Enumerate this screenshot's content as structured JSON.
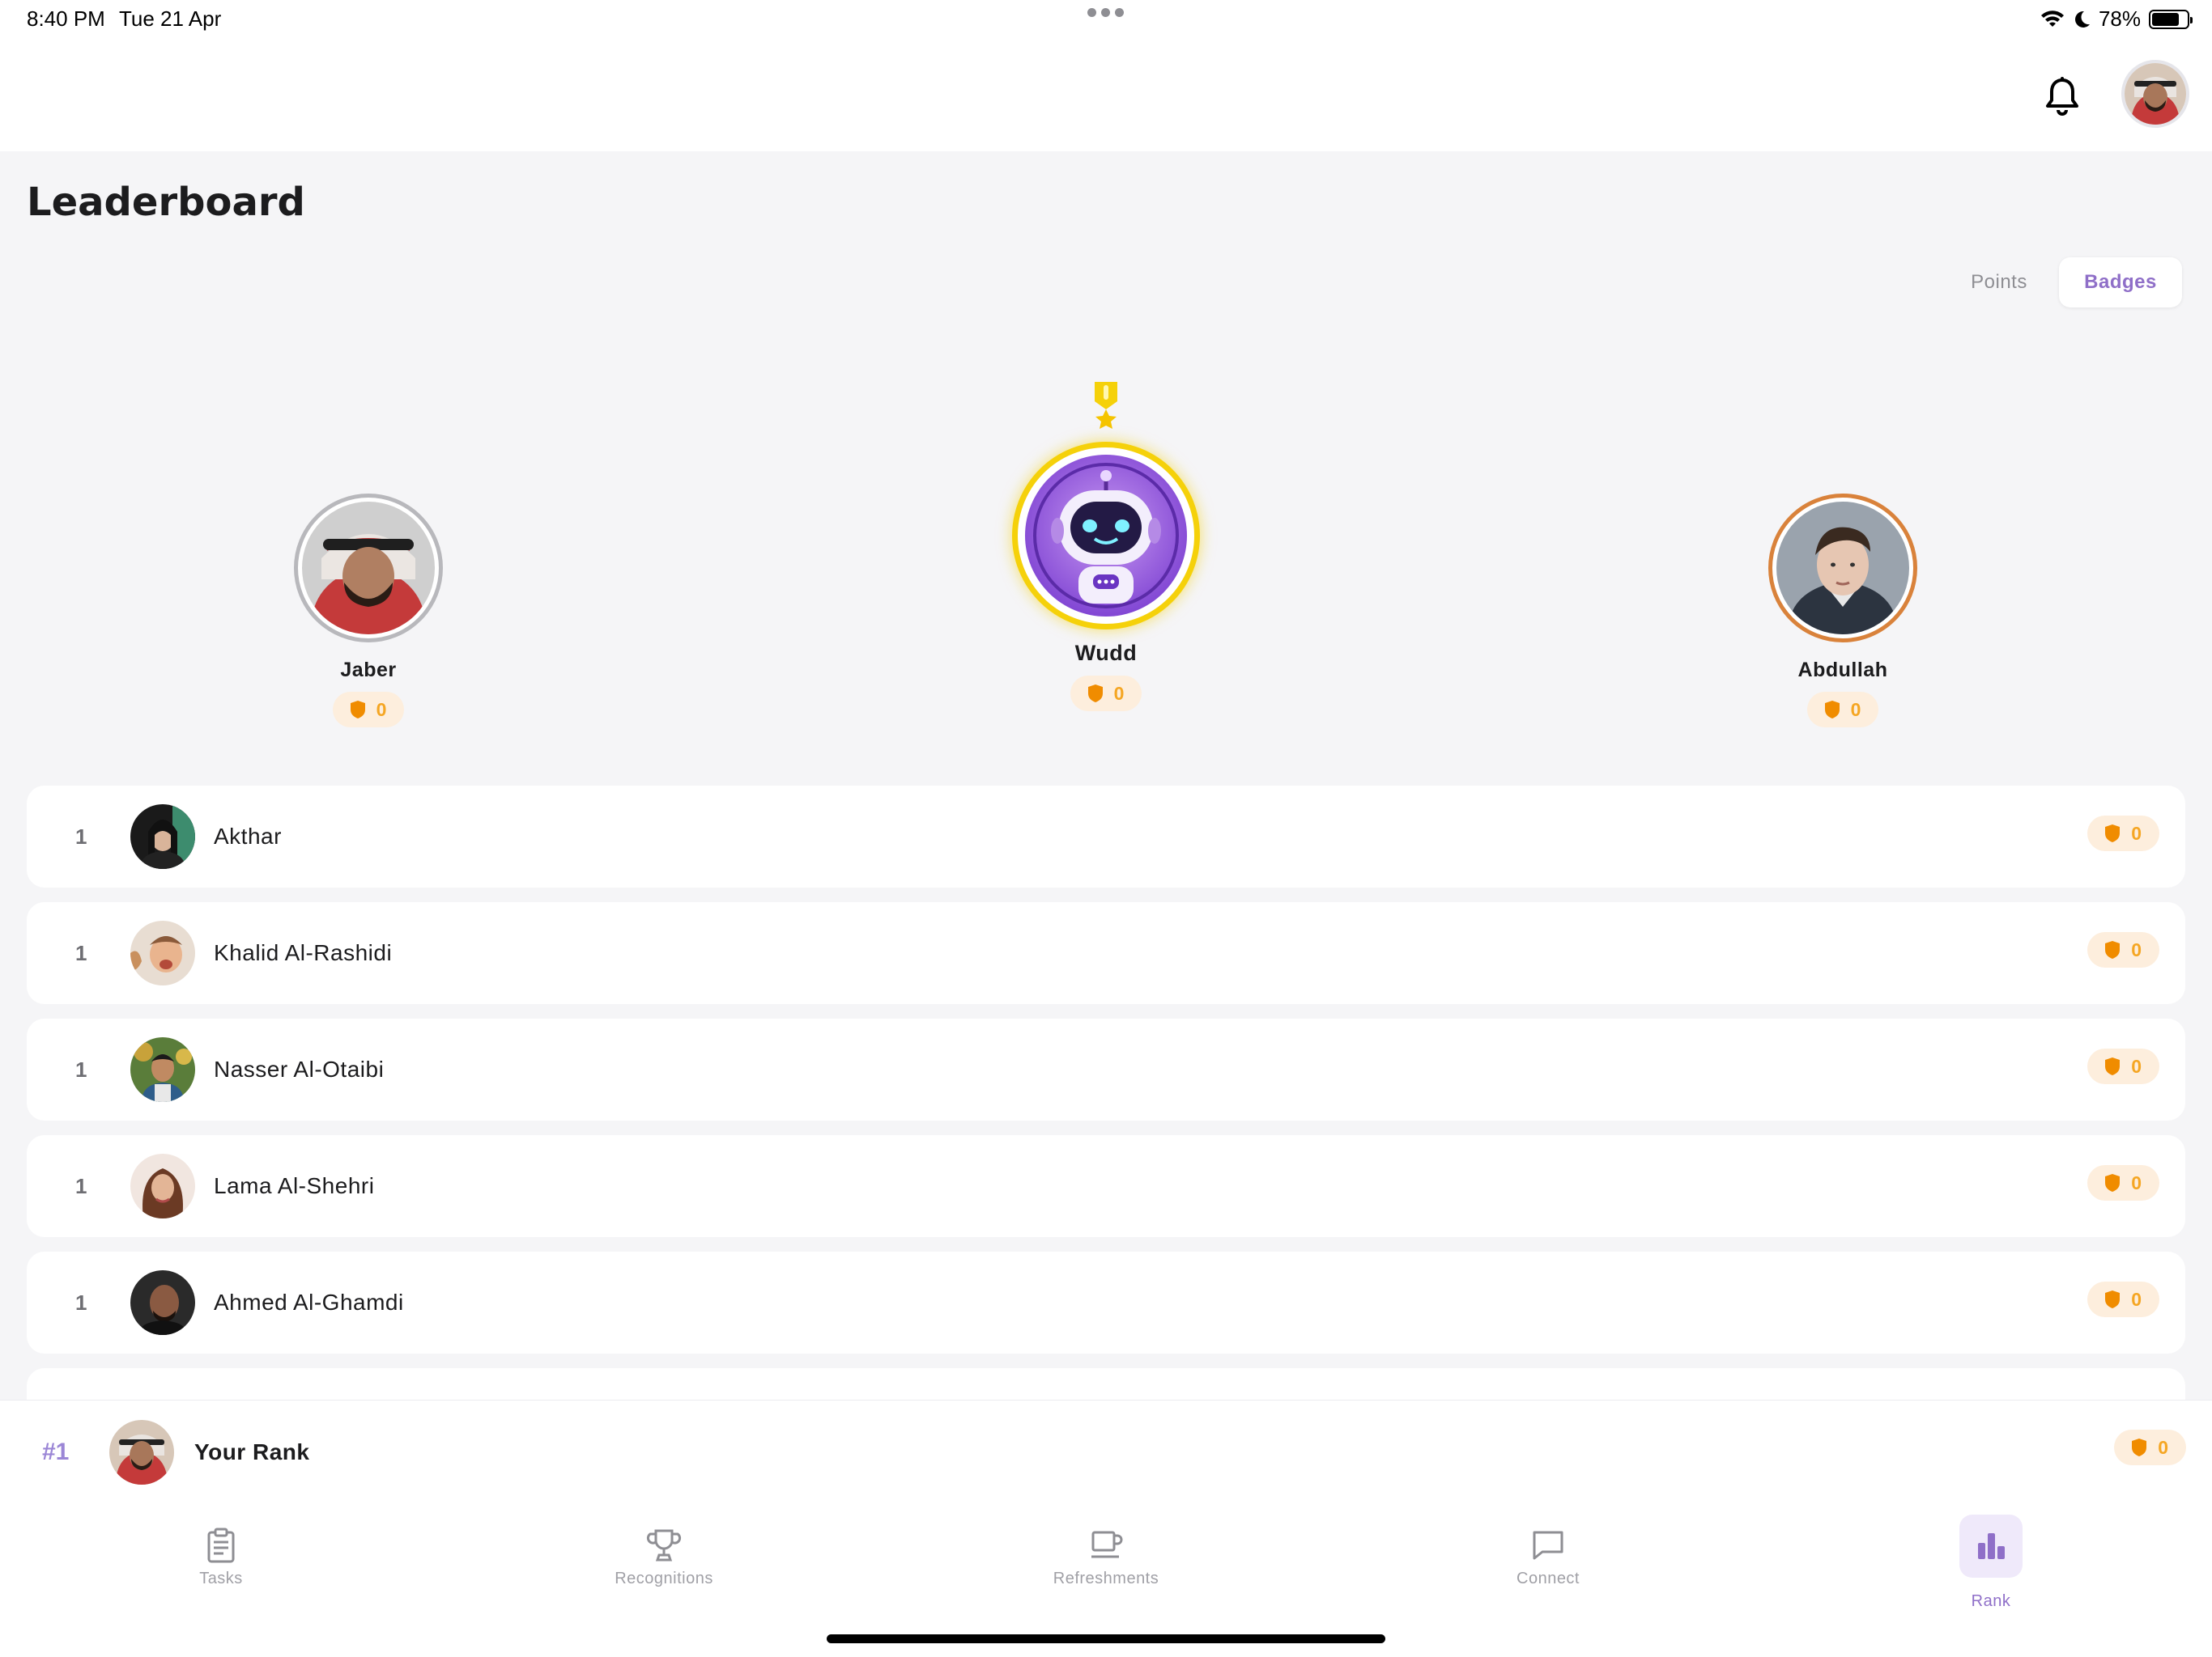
{
  "status_bar": {
    "time": "8:40 PM",
    "date": "Tue 21 Apr",
    "battery": "78%",
    "battery_level": 0.78
  },
  "header": {
    "notifications_icon": "bell-icon",
    "profile_icon": "avatar"
  },
  "page": {
    "title": "Leaderboard"
  },
  "segmented": {
    "points_label": "Points",
    "badges_label": "Badges",
    "selected": "Badges"
  },
  "podium": {
    "first": {
      "name": "Wudd",
      "badges": "0"
    },
    "second": {
      "name": "Jaber",
      "badges": "0"
    },
    "third": {
      "name": "Abdullah",
      "badges": "0"
    }
  },
  "list": [
    {
      "rank": "1",
      "name": "Akthar",
      "badges": "0"
    },
    {
      "rank": "1",
      "name": "Khalid Al-Rashidi",
      "badges": "0"
    },
    {
      "rank": "1",
      "name": "Nasser Al-Otaibi",
      "badges": "0"
    },
    {
      "rank": "1",
      "name": "Lama Al-Shehri",
      "badges": "0"
    },
    {
      "rank": "1",
      "name": "Ahmed Al-Ghamdi",
      "badges": "0"
    }
  ],
  "your_rank": {
    "rank": "#1",
    "label": "Your Rank",
    "badges": "0"
  },
  "tabs": [
    {
      "label": "Tasks",
      "icon": "clipboard-icon"
    },
    {
      "label": "Recognitions",
      "icon": "trophy-icon"
    },
    {
      "label": "Refreshments",
      "icon": "coffee-cup-icon"
    },
    {
      "label": "Connect",
      "icon": "chat-bubble-icon"
    },
    {
      "label": "Rank",
      "icon": "bar-chart-icon"
    }
  ],
  "colors": {
    "accent": "#8f6fc8",
    "badge_orange": "#f5a623",
    "gold": "#f5d10a",
    "bronze": "#d9823b",
    "silver": "#b8b8bc"
  }
}
